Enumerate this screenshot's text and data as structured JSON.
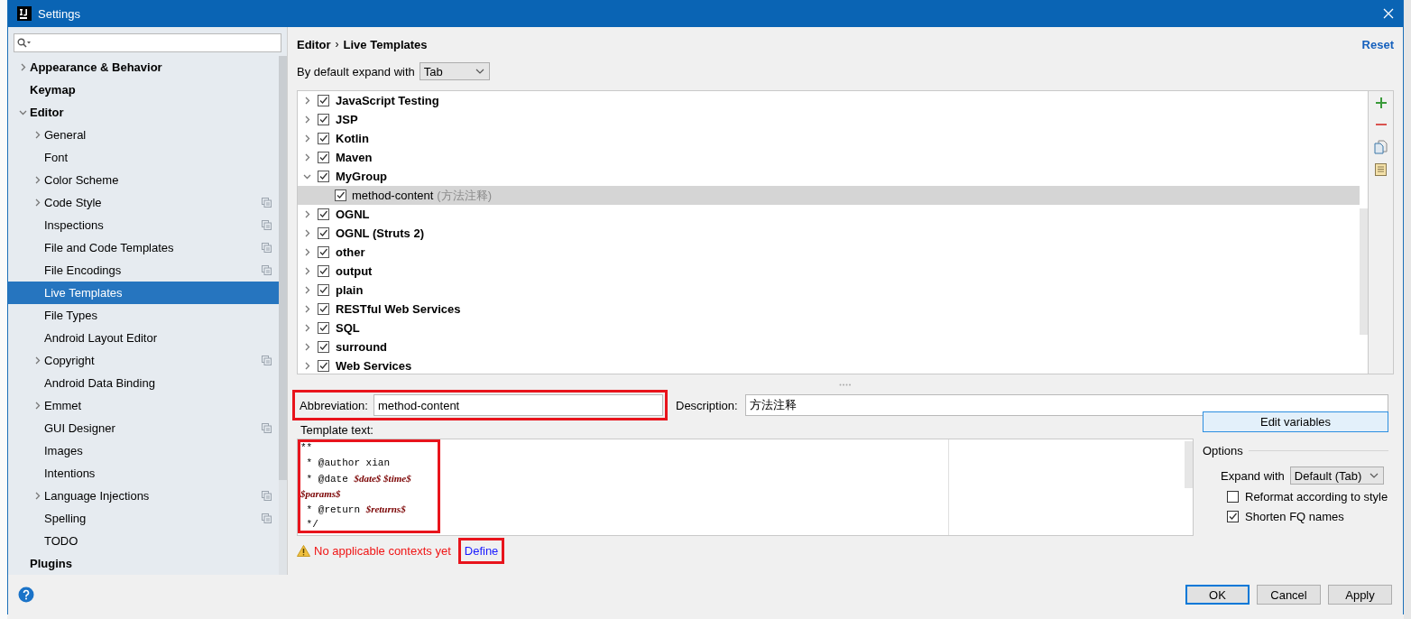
{
  "window": {
    "title": "Settings"
  },
  "sidebar": {
    "items": [
      {
        "label": "Appearance & Behavior",
        "kind": "folder",
        "expanded": false,
        "selected": false,
        "shared": false
      },
      {
        "label": "Keymap",
        "kind": "page",
        "selected": false,
        "shared": false
      },
      {
        "label": "Editor",
        "kind": "folder",
        "expanded": true,
        "selected": false,
        "shared": false,
        "children": [
          {
            "label": "General",
            "kind": "folder",
            "expanded": false,
            "selected": false,
            "shared": false
          },
          {
            "label": "Font",
            "kind": "page",
            "selected": false,
            "shared": false
          },
          {
            "label": "Color Scheme",
            "kind": "folder",
            "expanded": false,
            "selected": false,
            "shared": false
          },
          {
            "label": "Code Style",
            "kind": "folder",
            "expanded": false,
            "selected": false,
            "shared": true
          },
          {
            "label": "Inspections",
            "kind": "page",
            "selected": false,
            "shared": true
          },
          {
            "label": "File and Code Templates",
            "kind": "page",
            "selected": false,
            "shared": true
          },
          {
            "label": "File Encodings",
            "kind": "page",
            "selected": false,
            "shared": true
          },
          {
            "label": "Live Templates",
            "kind": "page",
            "selected": true,
            "shared": false
          },
          {
            "label": "File Types",
            "kind": "page",
            "selected": false,
            "shared": false
          },
          {
            "label": "Android Layout Editor",
            "kind": "page",
            "selected": false,
            "shared": false
          },
          {
            "label": "Copyright",
            "kind": "folder",
            "expanded": false,
            "selected": false,
            "shared": true
          },
          {
            "label": "Android Data Binding",
            "kind": "page",
            "selected": false,
            "shared": false
          },
          {
            "label": "Emmet",
            "kind": "folder",
            "expanded": false,
            "selected": false,
            "shared": false
          },
          {
            "label": "GUI Designer",
            "kind": "page",
            "selected": false,
            "shared": true
          },
          {
            "label": "Images",
            "kind": "page",
            "selected": false,
            "shared": false
          },
          {
            "label": "Intentions",
            "kind": "page",
            "selected": false,
            "shared": false
          },
          {
            "label": "Language Injections",
            "kind": "folder",
            "expanded": false,
            "selected": false,
            "shared": true
          },
          {
            "label": "Spelling",
            "kind": "page",
            "selected": false,
            "shared": true
          },
          {
            "label": "TODO",
            "kind": "page",
            "selected": false,
            "shared": false
          }
        ]
      },
      {
        "label": "Plugins",
        "kind": "page",
        "selected": false,
        "shared": false
      }
    ]
  },
  "breadcrumb": {
    "items": [
      "Editor",
      "Live Templates"
    ],
    "separator": "›"
  },
  "reset_link": "Reset",
  "expand_default": {
    "label": "By default expand with",
    "value": "Tab"
  },
  "template_groups": [
    {
      "name": "JavaScript Testing",
      "checked": true,
      "expanded": false,
      "selected": false
    },
    {
      "name": "JSP",
      "checked": true,
      "expanded": false,
      "selected": false
    },
    {
      "name": "Kotlin",
      "checked": true,
      "expanded": false,
      "selected": false
    },
    {
      "name": "Maven",
      "checked": true,
      "expanded": false,
      "selected": false
    },
    {
      "name": "MyGroup",
      "checked": true,
      "expanded": true,
      "selected": false,
      "children": [
        {
          "name": "method-content",
          "description": "(方法注释)",
          "checked": true,
          "selected": true
        }
      ]
    },
    {
      "name": "OGNL",
      "checked": true,
      "expanded": false,
      "selected": false
    },
    {
      "name": "OGNL (Struts 2)",
      "checked": true,
      "expanded": false,
      "selected": false
    },
    {
      "name": "other",
      "checked": true,
      "expanded": false,
      "selected": false
    },
    {
      "name": "output",
      "checked": true,
      "expanded": false,
      "selected": false
    },
    {
      "name": "plain",
      "checked": true,
      "expanded": false,
      "selected": false
    },
    {
      "name": "RESTful Web Services",
      "checked": true,
      "expanded": false,
      "selected": false
    },
    {
      "name": "SQL",
      "checked": true,
      "expanded": false,
      "selected": false
    },
    {
      "name": "surround",
      "checked": true,
      "expanded": false,
      "selected": false
    },
    {
      "name": "Web Services",
      "checked": true,
      "expanded": false,
      "selected": false
    }
  ],
  "abbreviation": {
    "label": "Abbreviation:",
    "value": "method-content",
    "highlighted": true
  },
  "description": {
    "label": "Description:",
    "value": "方法注释"
  },
  "template_text": {
    "label": "Template text:",
    "highlighted": true,
    "lines": [
      [
        {
          "text": "**",
          "kind": "plain"
        }
      ],
      [
        {
          "text": " * @author xian",
          "kind": "plain"
        }
      ],
      [
        {
          "text": " * @date ",
          "kind": "plain"
        },
        {
          "text": "$date$ $time$",
          "kind": "variable"
        }
      ],
      [
        {
          "text": "$params$",
          "kind": "variable"
        }
      ],
      [
        {
          "text": " * @return ",
          "kind": "plain"
        },
        {
          "text": "$returns$",
          "kind": "variable"
        }
      ],
      [
        {
          "text": " */",
          "kind": "plain"
        }
      ]
    ]
  },
  "warning": {
    "text": "No applicable contexts yet",
    "link": "Define",
    "link_highlighted": true
  },
  "edit_variables_button": "Edit variables",
  "options": {
    "title": "Options",
    "expand_with": {
      "label": "Expand with",
      "value": "Default (Tab)"
    },
    "checkboxes": [
      {
        "label": "Reformat according to style",
        "checked": false
      },
      {
        "label": "Shorten FQ names",
        "checked": true
      }
    ]
  },
  "buttons": [
    {
      "label": "OK",
      "default": true
    },
    {
      "label": "Cancel",
      "default": false
    },
    {
      "label": "Apply",
      "default": false
    }
  ]
}
